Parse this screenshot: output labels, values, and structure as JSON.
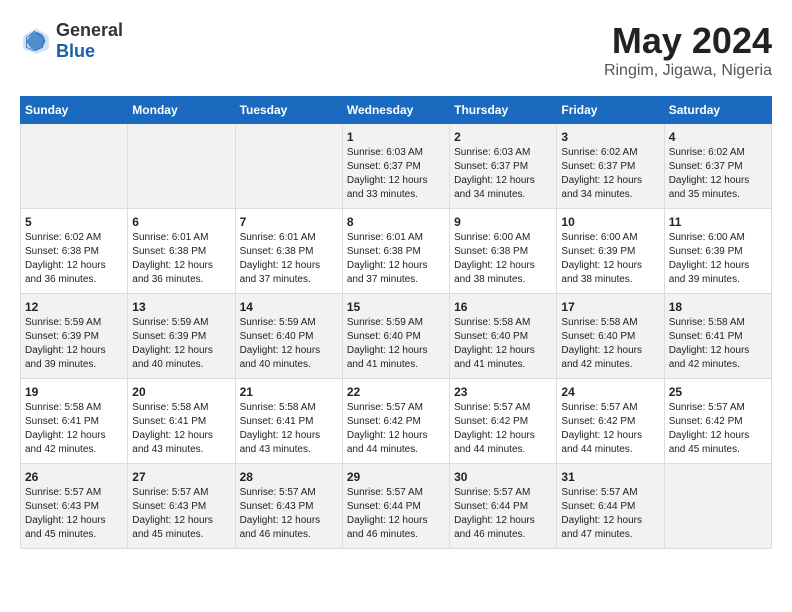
{
  "logo": {
    "text_general": "General",
    "text_blue": "Blue"
  },
  "header": {
    "month_year": "May 2024",
    "location": "Ringim, Jigawa, Nigeria"
  },
  "days_of_week": [
    "Sunday",
    "Monday",
    "Tuesday",
    "Wednesday",
    "Thursday",
    "Friday",
    "Saturday"
  ],
  "weeks": [
    [
      {
        "day": "",
        "info": ""
      },
      {
        "day": "",
        "info": ""
      },
      {
        "day": "",
        "info": ""
      },
      {
        "day": "1",
        "info": "Sunrise: 6:03 AM\nSunset: 6:37 PM\nDaylight: 12 hours\nand 33 minutes."
      },
      {
        "day": "2",
        "info": "Sunrise: 6:03 AM\nSunset: 6:37 PM\nDaylight: 12 hours\nand 34 minutes."
      },
      {
        "day": "3",
        "info": "Sunrise: 6:02 AM\nSunset: 6:37 PM\nDaylight: 12 hours\nand 34 minutes."
      },
      {
        "day": "4",
        "info": "Sunrise: 6:02 AM\nSunset: 6:37 PM\nDaylight: 12 hours\nand 35 minutes."
      }
    ],
    [
      {
        "day": "5",
        "info": "Sunrise: 6:02 AM\nSunset: 6:38 PM\nDaylight: 12 hours\nand 36 minutes."
      },
      {
        "day": "6",
        "info": "Sunrise: 6:01 AM\nSunset: 6:38 PM\nDaylight: 12 hours\nand 36 minutes."
      },
      {
        "day": "7",
        "info": "Sunrise: 6:01 AM\nSunset: 6:38 PM\nDaylight: 12 hours\nand 37 minutes."
      },
      {
        "day": "8",
        "info": "Sunrise: 6:01 AM\nSunset: 6:38 PM\nDaylight: 12 hours\nand 37 minutes."
      },
      {
        "day": "9",
        "info": "Sunrise: 6:00 AM\nSunset: 6:38 PM\nDaylight: 12 hours\nand 38 minutes."
      },
      {
        "day": "10",
        "info": "Sunrise: 6:00 AM\nSunset: 6:39 PM\nDaylight: 12 hours\nand 38 minutes."
      },
      {
        "day": "11",
        "info": "Sunrise: 6:00 AM\nSunset: 6:39 PM\nDaylight: 12 hours\nand 39 minutes."
      }
    ],
    [
      {
        "day": "12",
        "info": "Sunrise: 5:59 AM\nSunset: 6:39 PM\nDaylight: 12 hours\nand 39 minutes."
      },
      {
        "day": "13",
        "info": "Sunrise: 5:59 AM\nSunset: 6:39 PM\nDaylight: 12 hours\nand 40 minutes."
      },
      {
        "day": "14",
        "info": "Sunrise: 5:59 AM\nSunset: 6:40 PM\nDaylight: 12 hours\nand 40 minutes."
      },
      {
        "day": "15",
        "info": "Sunrise: 5:59 AM\nSunset: 6:40 PM\nDaylight: 12 hours\nand 41 minutes."
      },
      {
        "day": "16",
        "info": "Sunrise: 5:58 AM\nSunset: 6:40 PM\nDaylight: 12 hours\nand 41 minutes."
      },
      {
        "day": "17",
        "info": "Sunrise: 5:58 AM\nSunset: 6:40 PM\nDaylight: 12 hours\nand 42 minutes."
      },
      {
        "day": "18",
        "info": "Sunrise: 5:58 AM\nSunset: 6:41 PM\nDaylight: 12 hours\nand 42 minutes."
      }
    ],
    [
      {
        "day": "19",
        "info": "Sunrise: 5:58 AM\nSunset: 6:41 PM\nDaylight: 12 hours\nand 42 minutes."
      },
      {
        "day": "20",
        "info": "Sunrise: 5:58 AM\nSunset: 6:41 PM\nDaylight: 12 hours\nand 43 minutes."
      },
      {
        "day": "21",
        "info": "Sunrise: 5:58 AM\nSunset: 6:41 PM\nDaylight: 12 hours\nand 43 minutes."
      },
      {
        "day": "22",
        "info": "Sunrise: 5:57 AM\nSunset: 6:42 PM\nDaylight: 12 hours\nand 44 minutes."
      },
      {
        "day": "23",
        "info": "Sunrise: 5:57 AM\nSunset: 6:42 PM\nDaylight: 12 hours\nand 44 minutes."
      },
      {
        "day": "24",
        "info": "Sunrise: 5:57 AM\nSunset: 6:42 PM\nDaylight: 12 hours\nand 44 minutes."
      },
      {
        "day": "25",
        "info": "Sunrise: 5:57 AM\nSunset: 6:42 PM\nDaylight: 12 hours\nand 45 minutes."
      }
    ],
    [
      {
        "day": "26",
        "info": "Sunrise: 5:57 AM\nSunset: 6:43 PM\nDaylight: 12 hours\nand 45 minutes."
      },
      {
        "day": "27",
        "info": "Sunrise: 5:57 AM\nSunset: 6:43 PM\nDaylight: 12 hours\nand 45 minutes."
      },
      {
        "day": "28",
        "info": "Sunrise: 5:57 AM\nSunset: 6:43 PM\nDaylight: 12 hours\nand 46 minutes."
      },
      {
        "day": "29",
        "info": "Sunrise: 5:57 AM\nSunset: 6:44 PM\nDaylight: 12 hours\nand 46 minutes."
      },
      {
        "day": "30",
        "info": "Sunrise: 5:57 AM\nSunset: 6:44 PM\nDaylight: 12 hours\nand 46 minutes."
      },
      {
        "day": "31",
        "info": "Sunrise: 5:57 AM\nSunset: 6:44 PM\nDaylight: 12 hours\nand 47 minutes."
      },
      {
        "day": "",
        "info": ""
      }
    ]
  ]
}
